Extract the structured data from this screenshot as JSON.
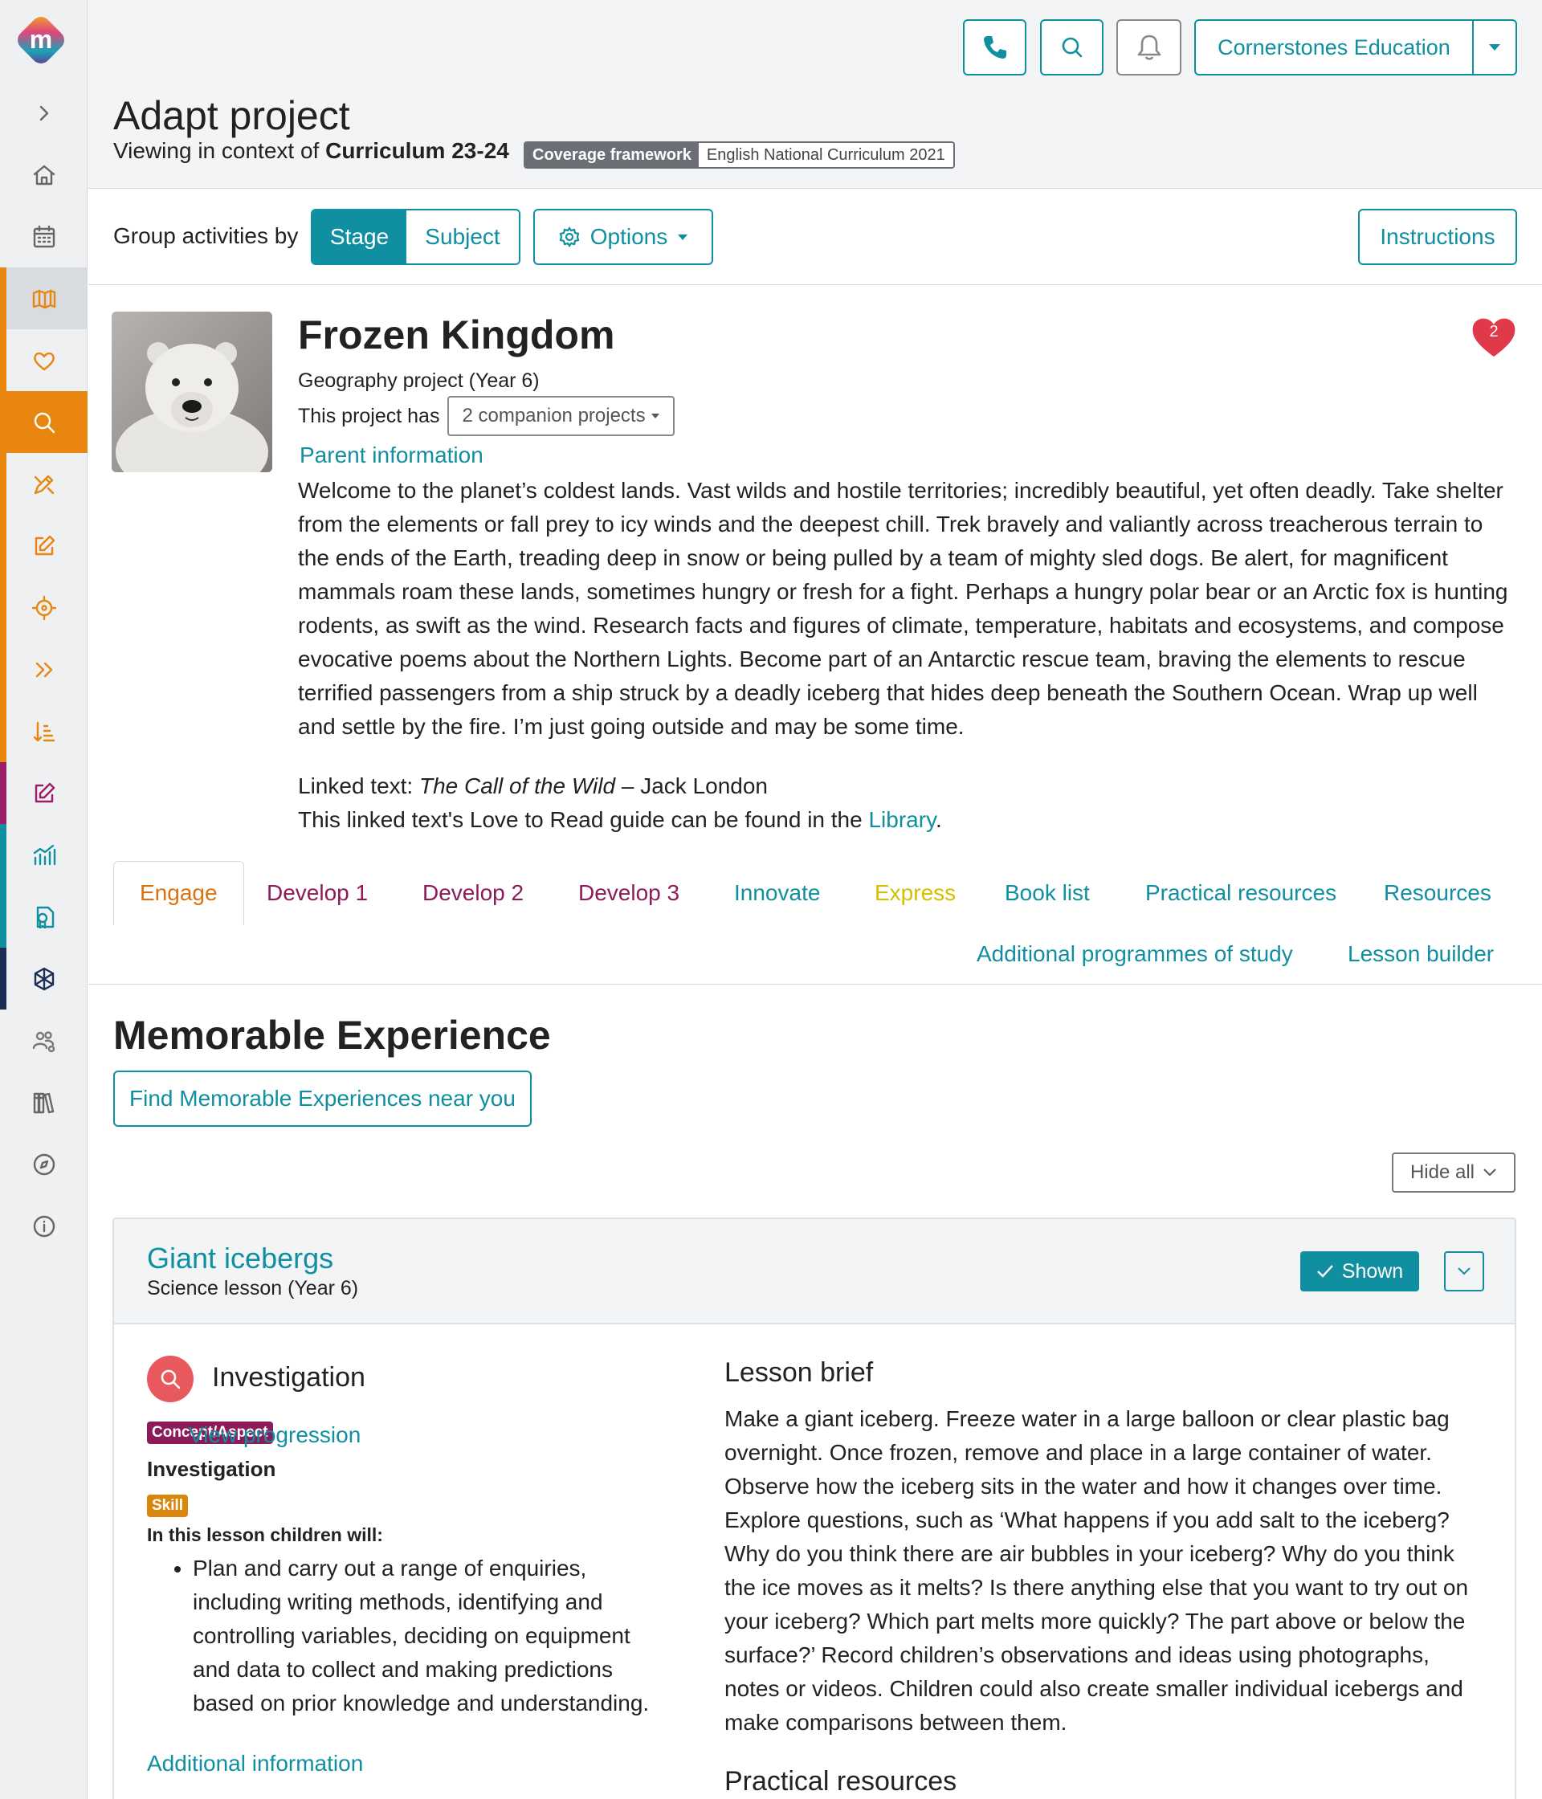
{
  "colors": {
    "teal": "#0f8fa0",
    "orange": "#e8860f",
    "engage": "#d9730d",
    "develop": "#8c1b5a",
    "express": "#d4c000",
    "sidebar_purple": "#9a1e6a",
    "sidebar_navy": "#1c2d55"
  },
  "sidebar": {
    "items": [
      {
        "name": "expand",
        "icon": "chevron-right-icon"
      },
      {
        "name": "home",
        "icon": "home-icon"
      },
      {
        "name": "calendar",
        "icon": "calendar-icon"
      },
      {
        "name": "projects",
        "icon": "map-icon"
      },
      {
        "name": "favourites",
        "icon": "heart-icon"
      },
      {
        "name": "search",
        "icon": "search-icon"
      },
      {
        "name": "design",
        "icon": "design-icon"
      },
      {
        "name": "edit",
        "icon": "edit-icon"
      },
      {
        "name": "target",
        "icon": "target-icon"
      },
      {
        "name": "progress",
        "icon": "chevrons-right-icon"
      },
      {
        "name": "sort",
        "icon": "sort-icon"
      },
      {
        "name": "assessment",
        "icon": "pencil-square-icon"
      },
      {
        "name": "analytics",
        "icon": "chart-icon"
      },
      {
        "name": "certificate",
        "icon": "certificate-icon"
      },
      {
        "name": "network",
        "icon": "network-icon"
      },
      {
        "name": "users",
        "icon": "users-settings-icon"
      },
      {
        "name": "library",
        "icon": "books-icon"
      },
      {
        "name": "explore",
        "icon": "compass-icon"
      },
      {
        "name": "info",
        "icon": "info-icon"
      }
    ]
  },
  "header": {
    "org_name": "Cornerstones Education",
    "title": "Adapt project",
    "context_prefix": "Viewing in context of",
    "context_value": "Curriculum 23-24",
    "coverage_key": "Coverage framework",
    "coverage_value": "English National Curriculum 2021"
  },
  "groupbar": {
    "label": "Group activities by",
    "stage": "Stage",
    "subject": "Subject",
    "options": "Options",
    "instructions": "Instructions"
  },
  "project": {
    "title": "Frozen Kingdom",
    "subtitle": "Geography project (Year 6)",
    "companion_prefix": "This project has",
    "companion_dropdown": "2 companion projects",
    "favourite_count": "2",
    "parent_info": "Parent information",
    "description": "Welcome to the planet’s coldest lands. Vast wilds and hostile territories; incredibly beautiful, yet often deadly. Take shelter from the elements or fall prey to icy winds and the deepest chill. Trek bravely and valiantly across treacherous terrain to the ends of the Earth, treading deep in snow or being pulled by a team of mighty sled dogs. Be alert, for magnificent mammals roam these lands, sometimes hungry or fresh for a fight. Perhaps a hungry polar bear or an Arctic fox is hunting rodents, as swift as the wind. Research facts and figures of climate, temperature, habitats and ecosystems, and compose evocative poems about the Northern Lights. Become part of an Antarctic rescue team, braving the elements to rescue terrified passengers from a ship struck by a deadly iceberg that hides deep beneath the Southern Ocean. Wrap up well and settle by the fire. I’m just going outside and may be some time.",
    "linked_prefix": "Linked text:",
    "linked_title": "The Call of the Wild",
    "linked_author": "– Jack London",
    "guide_prefix": "This linked text's Love to Read guide can be found in the",
    "guide_link": "Library",
    "guide_suffix": "."
  },
  "tabs": [
    {
      "label": "Engage"
    },
    {
      "label": "Develop 1"
    },
    {
      "label": "Develop 2"
    },
    {
      "label": "Develop 3"
    },
    {
      "label": "Innovate"
    },
    {
      "label": "Express"
    },
    {
      "label": "Book list"
    },
    {
      "label": "Practical resources"
    },
    {
      "label": "Resources"
    },
    {
      "label": "Additional programmes of study"
    },
    {
      "label": "Lesson builder"
    }
  ],
  "memorable": {
    "title": "Memorable Experience",
    "find_button": "Find Memorable Experiences near you",
    "hide_all": "Hide all"
  },
  "lesson": {
    "title": "Giant icebergs",
    "subtitle": "Science lesson (Year 6)",
    "shown": "Shown",
    "type": "Investigation",
    "concept_badge": "Concept/Aspect",
    "view_progression": "View progression",
    "concept_value": "Investigation",
    "skill_badge": "Skill",
    "in_lesson": "In this lesson children will:",
    "objectives": [
      "Plan and carry out a range of enquiries, including writing methods, identifying and controlling variables, deciding on equipment and data to collect and making predictions based on prior knowledge and understanding."
    ],
    "additional_info": "Additional information",
    "brief_title": "Lesson brief",
    "brief_text": "Make a giant iceberg. Freeze water in a large balloon or clear plastic bag overnight. Once frozen, remove and place in a large container of water. Observe how the iceberg sits in the water and how it changes over time. Explore questions, such as ‘What happens if you add salt to the iceberg? Why do you think there are air bubbles in your iceberg? Why do you think the ice moves as it melts? Is there anything else that you want to try out on your iceberg? Which part melts more quickly? The part above or below the surface?’ Record children’s observations and ideas using photographs, notes or videos. Children could also create smaller individual icebergs and make comparisons between them.",
    "practical_title": "Practical resources"
  }
}
